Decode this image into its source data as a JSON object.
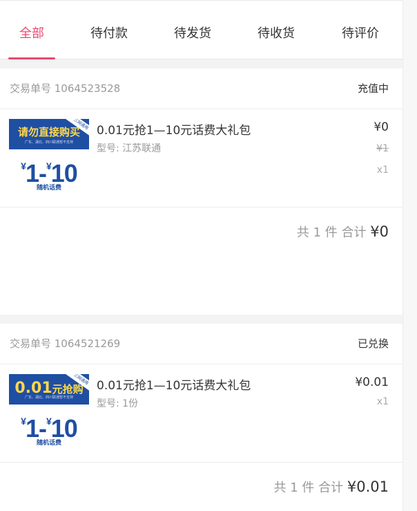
{
  "tabs": [
    {
      "label": "全部",
      "active": true
    },
    {
      "label": "待付款",
      "active": false
    },
    {
      "label": "待发货",
      "active": false
    },
    {
      "label": "待收货",
      "active": false
    },
    {
      "label": "待评价",
      "active": false
    }
  ],
  "orders": [
    {
      "order_label": "交易单号 1064523528",
      "status": "充值中",
      "item": {
        "name": "0.01元抢1—10元话费大礼包",
        "spec": "型号: 江苏联通",
        "price": "¥0",
        "original_price": "¥1",
        "qty": "x1",
        "thumb": {
          "corner": "三网通用",
          "title": "请勿直接购买",
          "subtitle": "广东、湖北、四川联通暂不支持",
          "price_from": "1",
          "price_to": "10",
          "foot": "随机话费"
        }
      },
      "summary": {
        "count_text": "共 1 件 合计",
        "total": "¥0"
      }
    },
    {
      "order_label": "交易单号 1064521269",
      "status": "已兑换",
      "item": {
        "name": "0.01元抢1—10元话费大礼包",
        "spec": "型号: 1份",
        "price": "¥0.01",
        "qty": "x1",
        "thumb": {
          "corner": "三网通用",
          "title_big": "0.01",
          "title_rest": "元抢购",
          "subtitle": "广东、湖北、四川联通暂不支持",
          "price_from": "1",
          "price_to": "10",
          "foot": "随机话费"
        }
      },
      "summary": {
        "count_text": "共 1 件 合计",
        "total": "¥0.01"
      }
    }
  ],
  "colors": {
    "accent": "#e94a6f",
    "thumb_blue": "#1f4fa3",
    "thumb_yellow": "#ffd84a"
  }
}
